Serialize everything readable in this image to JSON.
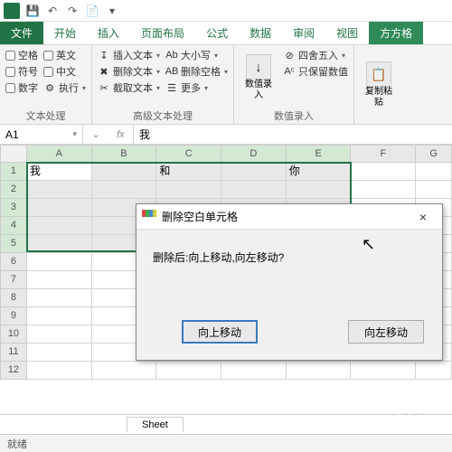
{
  "qat": {
    "save": "💾",
    "undo": "↶",
    "redo": "↷",
    "open": "📄"
  },
  "tabs": {
    "file": "文件",
    "items": [
      "开始",
      "插入",
      "页面布局",
      "公式",
      "数据",
      "审阅",
      "视图"
    ],
    "active": "方方格"
  },
  "ribbon": {
    "g1": {
      "label": "文本处理",
      "chk": {
        "blank": "空格",
        "symbol": "符号",
        "number": "数字",
        "en": "英文",
        "cn": "中文",
        "exec": "执行"
      },
      "exec_icon": "⚙"
    },
    "g2": {
      "label": "高级文本处理",
      "insert": "插入文本",
      "delete": "删除文本",
      "extract": "截取文本",
      "case": "大小写",
      "delblank": "删除空格",
      "more": "更多",
      "ic_insert": "↧",
      "ic_delete": "✖",
      "ic_extract": "✂",
      "ic_case": "Ab",
      "ic_delblank": "AB"
    },
    "g3": {
      "label": "数值录入",
      "rec": "数值录\n入",
      "rec_dd": "▾",
      "round": "四舍五入",
      "keepnum": "只保留数值",
      "ic_round": "⊘",
      "ic_keep": "Aᶜ"
    },
    "g4": {
      "paste": "复制粘\n贴",
      "paste_dd": "▾"
    }
  },
  "fx": {
    "name": "A1",
    "fx": "fx",
    "value": "我"
  },
  "grid": {
    "cols": [
      "A",
      "B",
      "C",
      "D",
      "E",
      "F",
      "G"
    ],
    "rows": [
      "1",
      "2",
      "3",
      "4",
      "5",
      "6",
      "7",
      "8",
      "9",
      "10",
      "11",
      "12"
    ],
    "data": {
      "A1": "我",
      "C1": "和",
      "E1": "你"
    },
    "sel": {
      "r1": 1,
      "c1": 1,
      "r2": 5,
      "c2": 5
    }
  },
  "dialog": {
    "title": "删除空白单元格",
    "message": "删除后:向上移动,向左移动?",
    "up": "向上移动",
    "left": "向左移动",
    "close": "×"
  },
  "sheet": {
    "tab": "Sheet",
    "add": "+"
  },
  "status": {
    "ready": "就绪"
  },
  "watermark": "© jb51.net"
}
